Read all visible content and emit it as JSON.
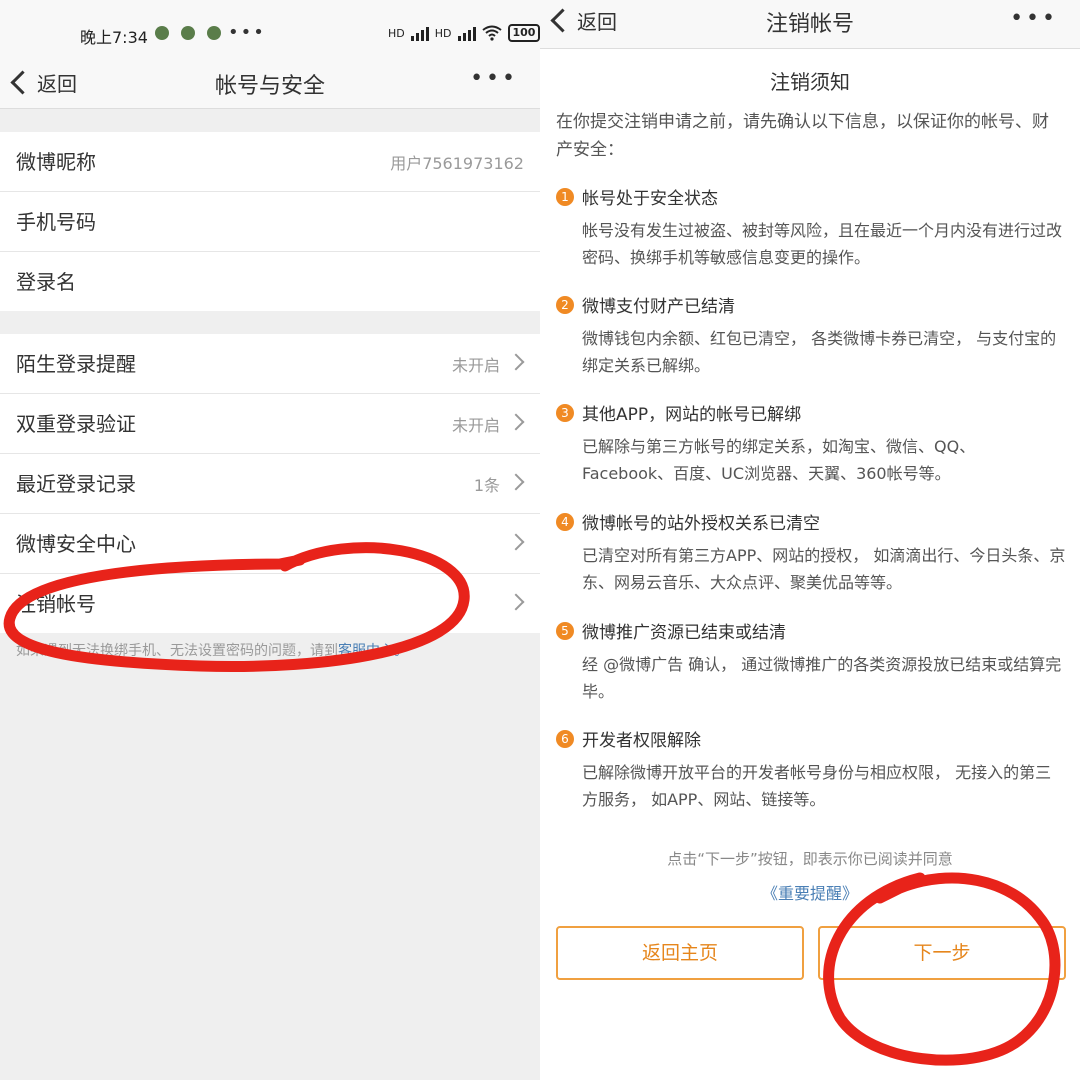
{
  "left": {
    "status": {
      "time": "晚上7:34",
      "battery": "100",
      "net1": "HD",
      "net2": "HD"
    },
    "nav": {
      "back": "返回",
      "title": "帐号与安全"
    },
    "group1": [
      {
        "label": "微博昵称",
        "value": "用户7561973162"
      },
      {
        "label": "手机号码",
        "value": ""
      },
      {
        "label": "登录名",
        "value": ""
      }
    ],
    "group2": [
      {
        "label": "陌生登录提醒",
        "value": "未开启"
      },
      {
        "label": "双重登录验证",
        "value": "未开启"
      },
      {
        "label": "最近登录记录",
        "value": "1条"
      },
      {
        "label": "微博安全中心",
        "value": ""
      },
      {
        "label": "注销帐号",
        "value": ""
      }
    ],
    "footnote": {
      "text": "如果遇到无法换绑手机、无法设置密码的问题，请到",
      "link": "客服中心。"
    }
  },
  "right": {
    "nav": {
      "back": "返回",
      "title": "注销帐号"
    },
    "notice_title": "注销须知",
    "intro": "在你提交注销申请之前，请先确认以下信息，以保证你的帐号、财产安全：",
    "items": [
      {
        "num": "1",
        "title": "帐号处于安全状态",
        "desc": "帐号没有发生过被盗、被封等风险，且在最近一个月内没有进行过改密码、换绑手机等敏感信息变更的操作。"
      },
      {
        "num": "2",
        "title": "微博支付财产已结清",
        "desc": "微博钱包内余额、红包已清空， 各类微博卡券已清空， 与支付宝的绑定关系已解绑。"
      },
      {
        "num": "3",
        "title": "其他APP，网站的帐号已解绑",
        "desc": "已解除与第三方帐号的绑定关系，如淘宝、微信、QQ、Facebook、百度、UC浏览器、天翼、360帐号等。"
      },
      {
        "num": "4",
        "title": "微博帐号的站外授权关系已清空",
        "desc": "已清空对所有第三方APP、网站的授权， 如滴滴出行、今日头条、京东、网易云音乐、大众点评、聚美优品等等。"
      },
      {
        "num": "5",
        "title": "微博推广资源已结束或结清",
        "desc": "经 @微博广告 确认， 通过微博推广的各类资源投放已结束或结算完毕。"
      },
      {
        "num": "6",
        "title": "开发者权限解除",
        "desc": "已解除微博开放平台的开发者帐号身份与相应权限， 无接入的第三方服务， 如APP、网站、链接等。"
      }
    ],
    "agree_text": "点击“下一步”按钮，即表示你已阅读并同意",
    "reminder_link": "《重要提醒》",
    "buttons": {
      "home": "返回主页",
      "next": "下一步"
    }
  },
  "colors": {
    "accent": "#f08a24",
    "link": "#4a7fb5",
    "annotation": "#e8231a"
  }
}
